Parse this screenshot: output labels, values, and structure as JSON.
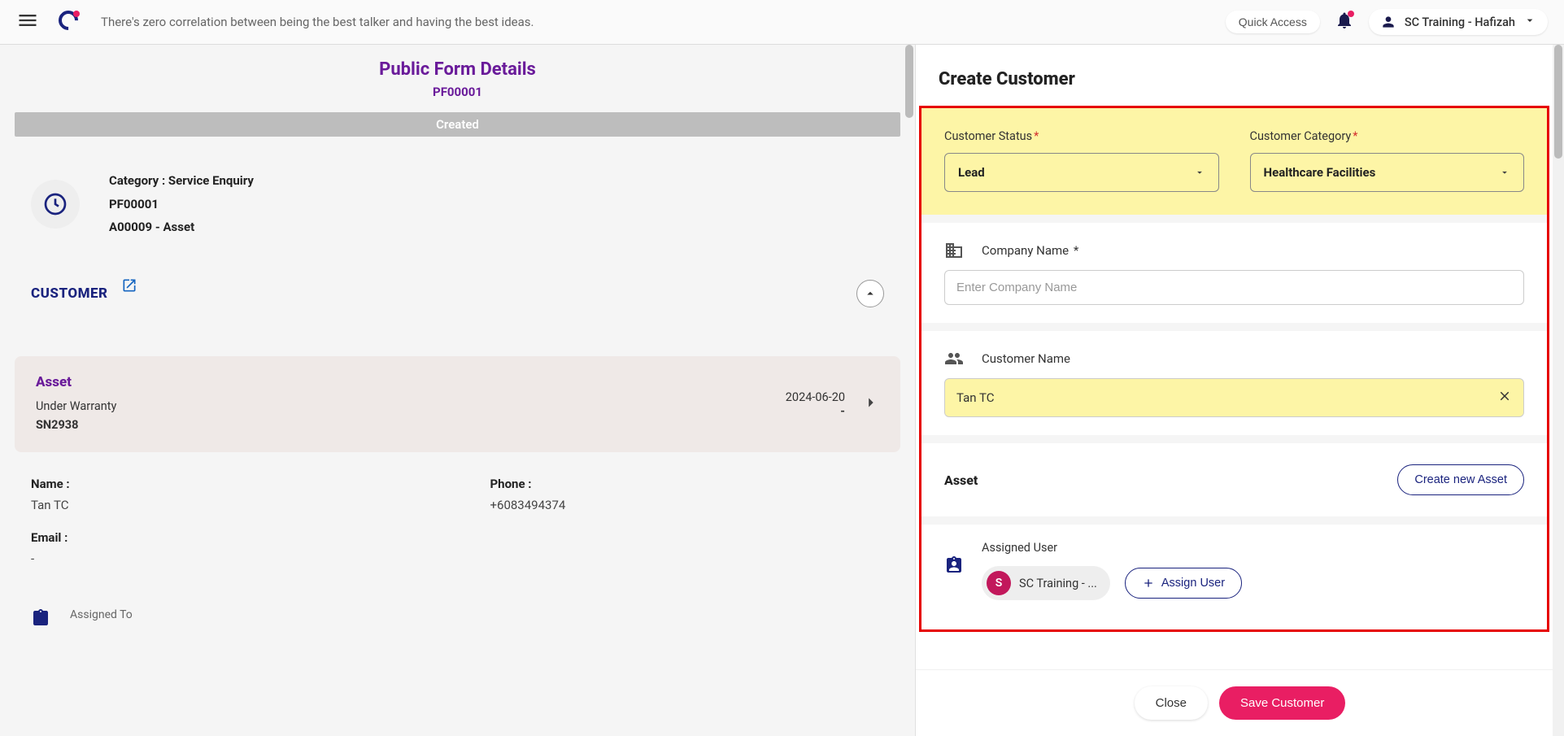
{
  "header": {
    "quote": "There's zero correlation between being the best talker and having the best ideas.",
    "quick_access_label": "Quick Access",
    "user_name": "SC Training - Hafizah"
  },
  "left": {
    "title": "Public Form Details",
    "form_id": "PF00001",
    "status": "Created",
    "meta": {
      "category_line": "Category : Service Enquiry",
      "pf_id": "PF00001",
      "asset": "A00009 - Asset"
    },
    "customer_section_title": "CUSTOMER",
    "asset_card": {
      "heading": "Asset",
      "warranty": "Under Warranty",
      "sn": "SN2938",
      "date": "2024-06-20",
      "dash": "-"
    },
    "details": {
      "name_label": "Name :",
      "name_value": "Tan TC",
      "phone_label": "Phone :",
      "phone_value": "+6083494374",
      "email_label": "Email :",
      "email_value": "-"
    },
    "assigned_to_label": "Assigned To"
  },
  "right": {
    "title": "Create Customer",
    "status_label": "Customer Status",
    "status_value": "Lead",
    "category_label": "Customer Category",
    "category_value": "Healthcare Facilities",
    "company_label": "Company Name",
    "company_placeholder": "Enter Company Name",
    "customer_name_label": "Customer Name",
    "customer_name_value": "Tan TC",
    "asset_heading": "Asset",
    "create_asset_label": "Create new Asset",
    "assigned_user_label": "Assigned User",
    "assigned_user_initial": "S",
    "assigned_user_name": "SC Training - ...",
    "assign_user_btn": "Assign User",
    "close_label": "Close",
    "save_label": "Save Customer"
  }
}
